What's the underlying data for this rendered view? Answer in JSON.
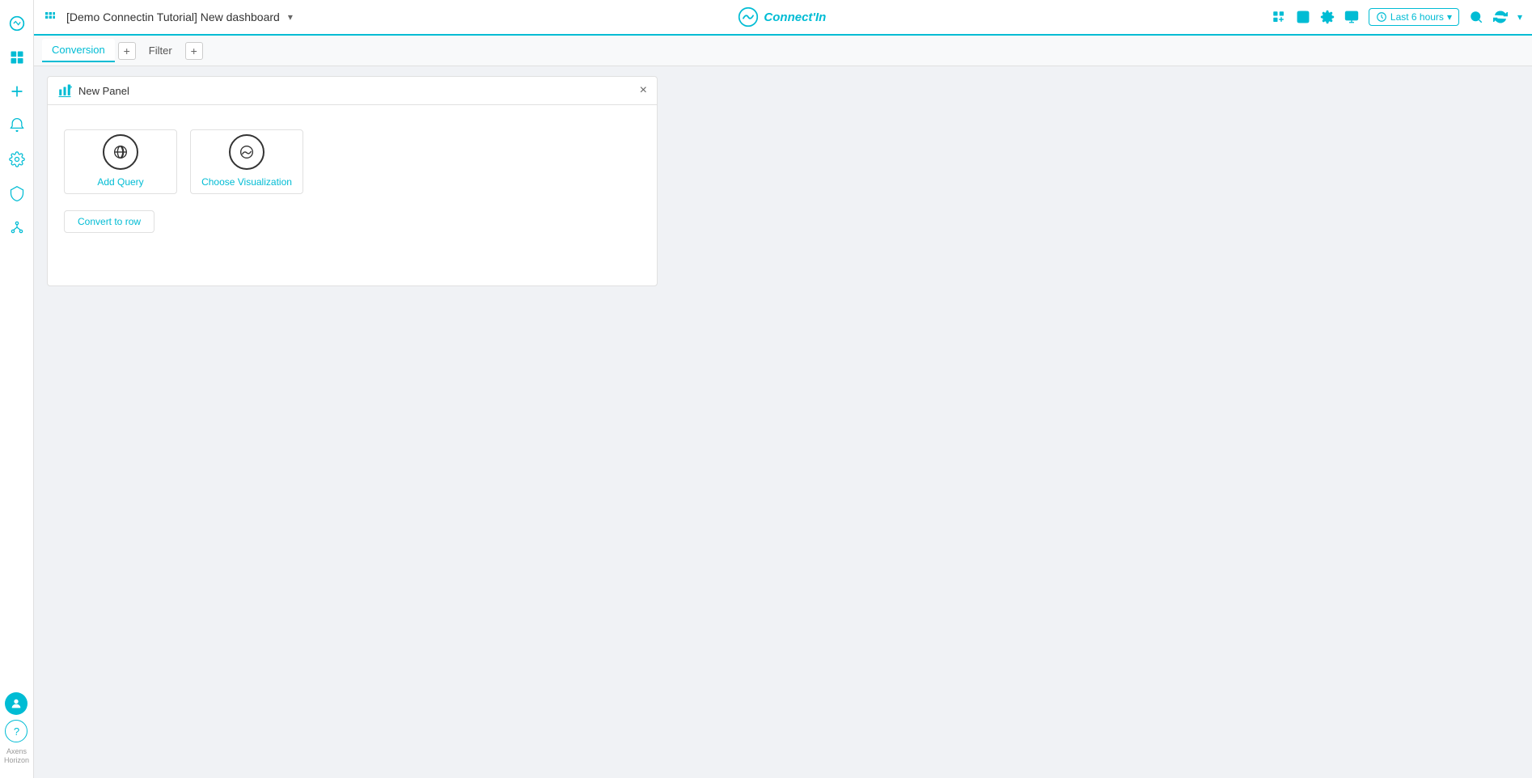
{
  "sidebar": {
    "items": [
      {
        "label": "Dashboard",
        "icon": "grid-icon"
      },
      {
        "label": "Add",
        "icon": "plus-icon"
      },
      {
        "label": "Notifications",
        "icon": "bell-icon"
      },
      {
        "label": "Settings",
        "icon": "gear-icon"
      },
      {
        "label": "Shield",
        "icon": "shield-icon"
      },
      {
        "label": "Network",
        "icon": "network-icon"
      }
    ],
    "bottom": {
      "avatar_label": "U",
      "help_label": "?",
      "brand_line1": "Axens",
      "brand_line2": "Horizon"
    }
  },
  "topbar": {
    "title": "[Demo Connectin Tutorial] New dashboard",
    "arrow": "▾",
    "logo_text": "Connect'In",
    "time_label": "Last 6 hours",
    "time_arrow": "▾"
  },
  "tabs": [
    {
      "label": "Conversion",
      "active": true
    },
    {
      "label": "Filter",
      "active": false
    }
  ],
  "panel": {
    "title": "New Panel",
    "close_label": "×",
    "options": [
      {
        "label": "Add Query",
        "icon": "query-icon"
      },
      {
        "label": "Choose Visualization",
        "icon": "chart-icon"
      }
    ],
    "convert_label": "Convert to row"
  }
}
